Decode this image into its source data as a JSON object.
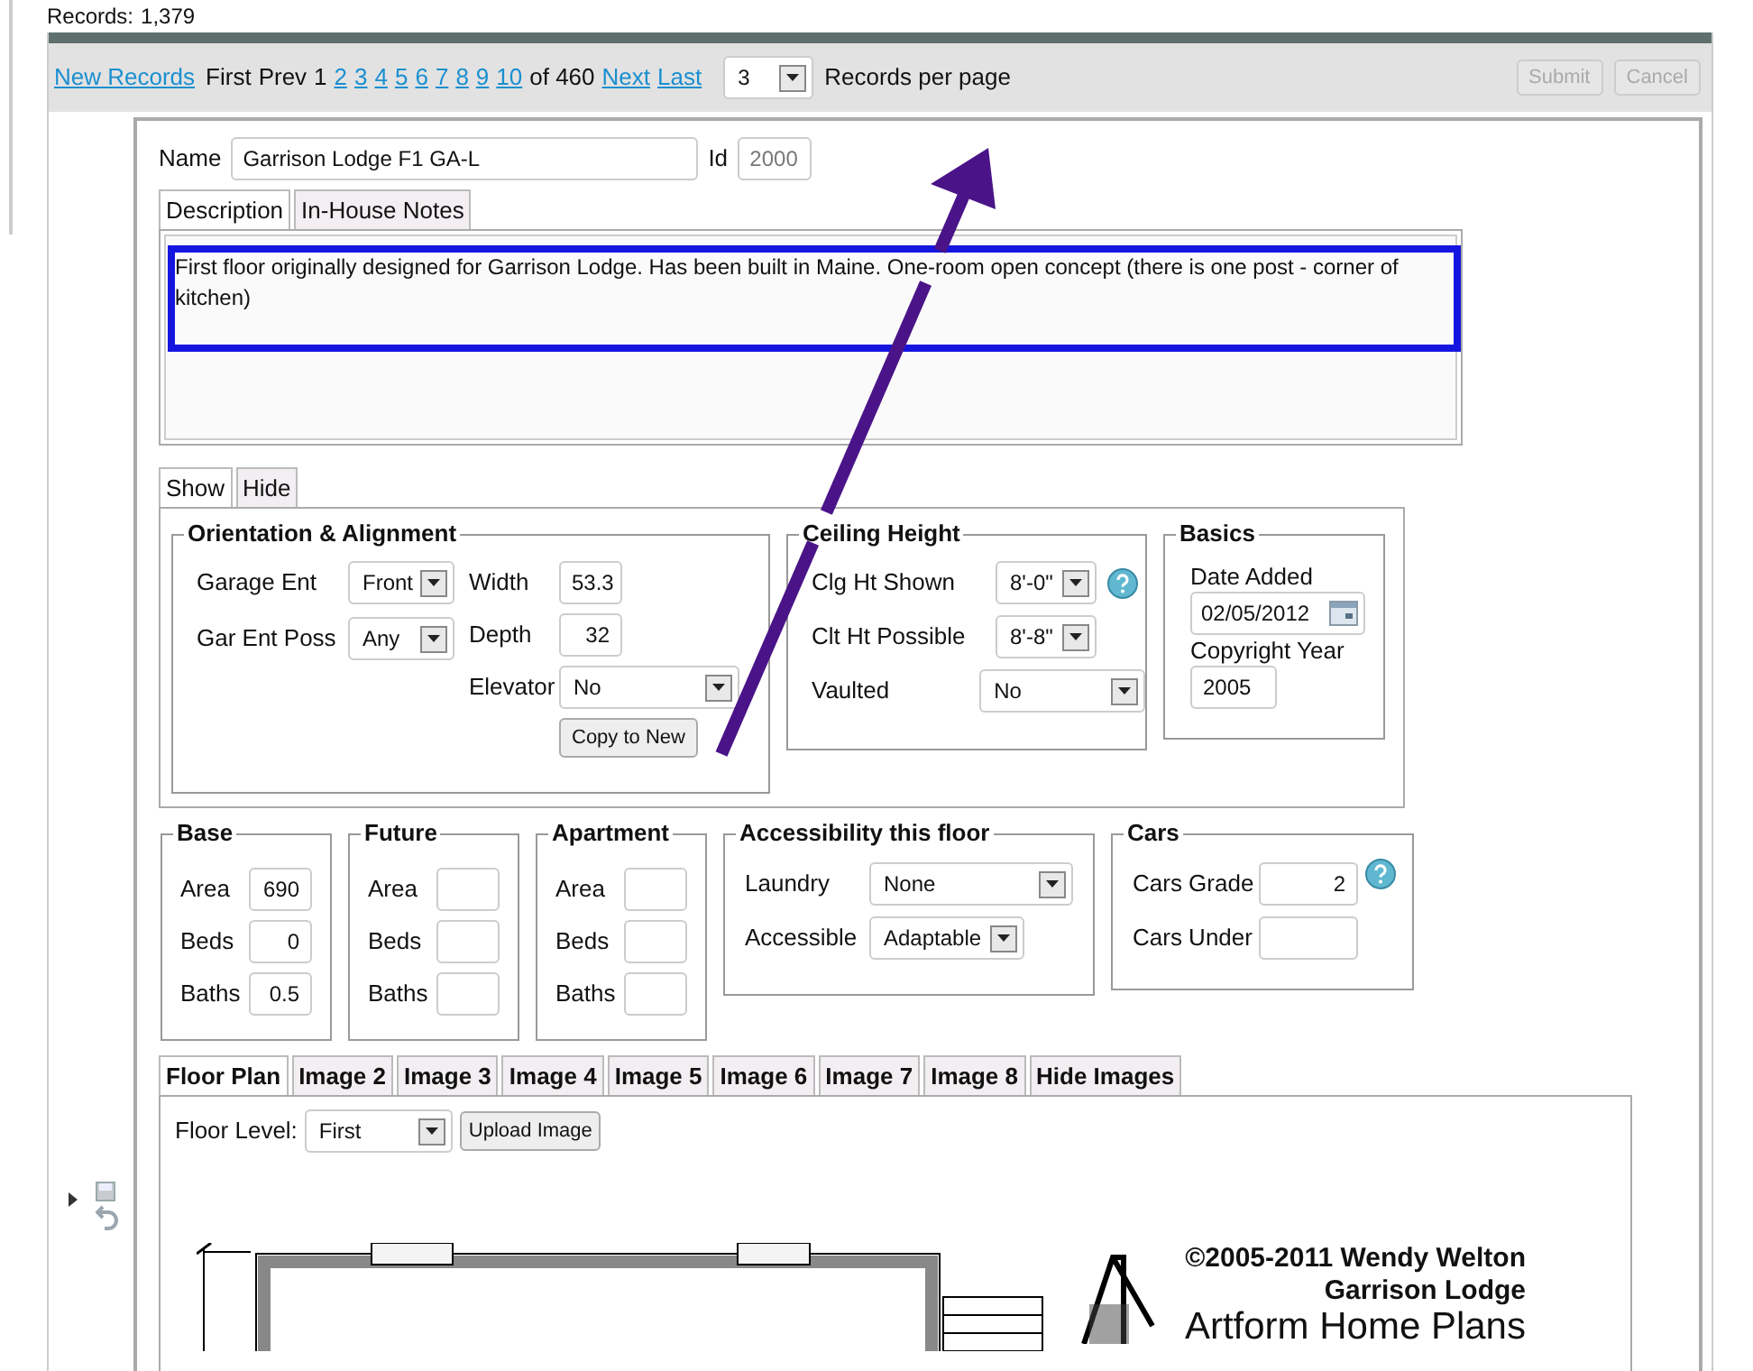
{
  "records": {
    "label": "Records:",
    "count": "1,379"
  },
  "pager": {
    "new_records": "New Records",
    "first": "First",
    "prev": "Prev",
    "pages": [
      {
        "label": "1",
        "selected": true
      },
      {
        "label": "2",
        "selected": false
      },
      {
        "label": "3",
        "selected": false
      },
      {
        "label": "4",
        "selected": false
      },
      {
        "label": "5",
        "selected": false
      },
      {
        "label": "6",
        "selected": false
      },
      {
        "label": "7",
        "selected": false
      },
      {
        "label": "8",
        "selected": false
      },
      {
        "label": "9",
        "selected": false
      },
      {
        "label": "10",
        "selected": false
      }
    ],
    "of": "of 460",
    "next": "Next",
    "last": "Last",
    "per_page": "3",
    "per_page_label": "Records per page",
    "buttons": [
      {
        "label": "Submit",
        "disabled": true
      },
      {
        "label": "Cancel",
        "disabled": true
      }
    ]
  },
  "name": {
    "label": "Name",
    "value": "Garrison Lodge F1 GA-L"
  },
  "id": {
    "label": "Id",
    "value": "2000"
  },
  "desc_tabs": [
    {
      "label": "Description",
      "selected": true
    },
    {
      "label": "In-House Notes",
      "selected": false
    }
  ],
  "description": "First floor originally designed for Garrison Lodge.  Has been built in Maine. One-room open concept (there is one post - corner of kitchen)",
  "show_tabs": [
    {
      "label": "Show",
      "selected": true
    },
    {
      "label": "Hide",
      "selected": false
    }
  ],
  "orientation": {
    "title": "Orientation & Alignment",
    "left": [
      {
        "label": "Garage Ent",
        "kind": "select",
        "value": "Front"
      },
      {
        "label": "Gar Ent Poss",
        "kind": "select",
        "value": "Any"
      }
    ],
    "right": [
      {
        "label": "Width",
        "kind": "input",
        "value": "53.3"
      },
      {
        "label": "Depth",
        "kind": "input",
        "value": "32"
      },
      {
        "label": "Elevator",
        "kind": "wideselect",
        "value": "No"
      }
    ],
    "button": "Copy to New"
  },
  "ceiling": {
    "title": "Ceiling Height",
    "fields": [
      {
        "label": "Clg Ht Shown",
        "kind": "select",
        "value": "8'-0\"",
        "help": true
      },
      {
        "label": "Clt Ht Possible",
        "kind": "select",
        "value": "8'-8\"",
        "help": false
      },
      {
        "label": "Vaulted",
        "kind": "wideselect",
        "value": "No",
        "help": false
      }
    ]
  },
  "basics": {
    "title": "Basics",
    "fields": [
      {
        "label": "Date Added",
        "kind": "date",
        "value": "02/05/2012"
      },
      {
        "label": "Copyright Year",
        "kind": "input",
        "value": "2005"
      }
    ]
  },
  "groups": [
    {
      "title": "Base",
      "fields": [
        {
          "label": "Area",
          "value": "690"
        },
        {
          "label": "Beds",
          "value": "0"
        },
        {
          "label": "Baths",
          "value": "0.5"
        }
      ]
    },
    {
      "title": "Future",
      "fields": [
        {
          "label": "Area"
        },
        {
          "label": "Beds"
        },
        {
          "label": "Baths"
        }
      ]
    },
    {
      "title": "Apartment",
      "fields": [
        {
          "label": "Area"
        },
        {
          "label": "Beds"
        },
        {
          "label": "Baths"
        }
      ]
    }
  ],
  "accessibility": {
    "title": "Accessibility this floor",
    "fields": [
      {
        "label": "Laundry",
        "value": "None"
      },
      {
        "label": "Accessible",
        "value": "Adaptable"
      }
    ]
  },
  "cars": {
    "title": "Cars",
    "fields": [
      {
        "label": "Cars Grade",
        "value": "2",
        "help": true
      },
      {
        "label": "Cars Under",
        "help": false
      }
    ]
  },
  "image_tabs": [
    {
      "label": "Floor Plan",
      "selected": true
    },
    {
      "label": "Image 2",
      "selected": false
    },
    {
      "label": "Image 3",
      "selected": false
    },
    {
      "label": "Image 4",
      "selected": false
    },
    {
      "label": "Image 5",
      "selected": false
    },
    {
      "label": "Image 6",
      "selected": false
    },
    {
      "label": "Image 7",
      "selected": false
    },
    {
      "label": "Image 8",
      "selected": false
    },
    {
      "label": "Hide Images",
      "selected": false
    }
  ],
  "floor_level": {
    "label": "Floor Level:",
    "value": "First"
  },
  "upload": "Upload Image",
  "plan_credits": [
    "©2005-2011 Wendy Welton",
    "Garrison Lodge",
    "Artform Home Plans"
  ]
}
